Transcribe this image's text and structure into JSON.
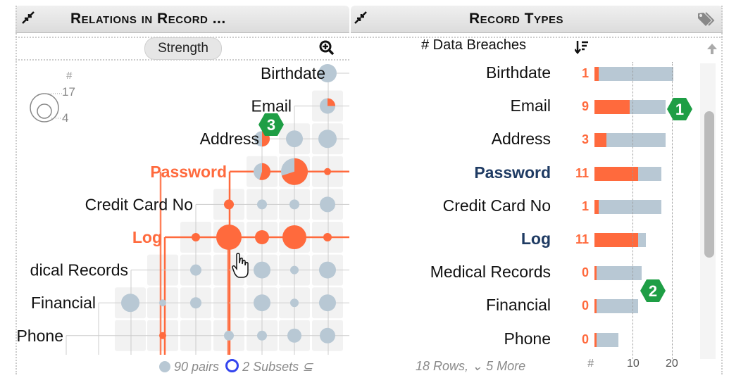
{
  "left_panel": {
    "title": "Relations in Record ...",
    "strength_label": "Strength",
    "legend": {
      "header": "#",
      "max": "17",
      "min": "4"
    },
    "rows": [
      "Birthdate",
      "Email",
      "Address",
      "Password",
      "Credit Card No",
      "Log",
      "dical Records",
      "Financial",
      "Phone"
    ],
    "highlighted": [
      "Password",
      "Log"
    ],
    "footer": {
      "pairs": "90 pairs",
      "subsets": "2 Subsets ⊆"
    },
    "badge": "3"
  },
  "right_panel": {
    "title": "Record Types",
    "column_header": "# Data Breaches",
    "rows": [
      {
        "label": "Birthdate",
        "count": "1",
        "total": 20,
        "highlight": false
      },
      {
        "label": "Email",
        "count": "9",
        "total": 18,
        "highlight": false
      },
      {
        "label": "Address",
        "count": "3",
        "total": 18,
        "highlight": false
      },
      {
        "label": "Password",
        "count": "11",
        "total": 17,
        "highlight": true
      },
      {
        "label": "Credit Card No",
        "count": "1",
        "total": 17,
        "highlight": false
      },
      {
        "label": "Log",
        "count": "11",
        "total": 13,
        "highlight": true
      },
      {
        "label": "Medical Records",
        "count": "0",
        "total": 12,
        "highlight": false
      },
      {
        "label": "Financial",
        "count": "0",
        "total": 11,
        "highlight": false
      },
      {
        "label": "Phone",
        "count": "0",
        "total": 6,
        "highlight": false
      }
    ],
    "footer": "18 Rows, ⌄ 5 More",
    "axis": {
      "label": "#",
      "ticks": [
        "10",
        "20"
      ]
    },
    "badges": [
      "1",
      "2"
    ]
  },
  "colors": {
    "accent": "#ff6a3d",
    "bar": "#b8c8d4",
    "highlight_text": "#1f3b63",
    "badge": "#1e9e45"
  }
}
